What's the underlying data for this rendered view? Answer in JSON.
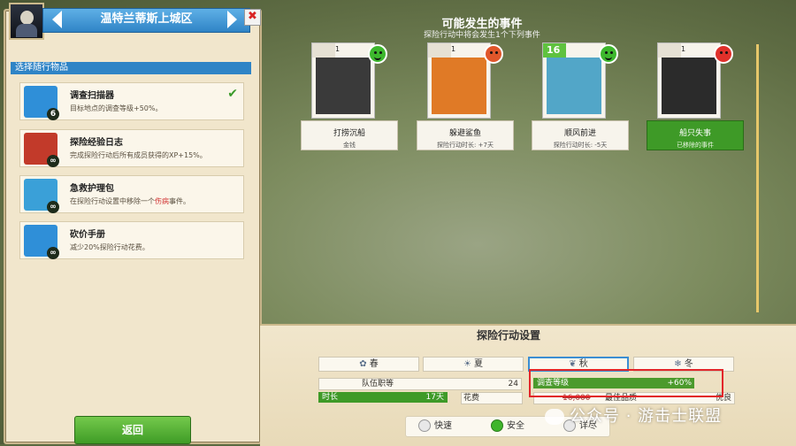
{
  "left_panel": {
    "location": "温特兰蒂斯上城区",
    "close_label": "✖",
    "section_title": "选择随行物品",
    "items": [
      {
        "name": "调查扫描器",
        "desc": "目标地点的调查等级+50%。",
        "badge": "6",
        "selected": true,
        "color": "#2f8fd8"
      },
      {
        "name": "探险经验日志",
        "desc": "完成探险行动后所有成员获得的XP+15%。",
        "badge": "∞",
        "selected": false,
        "color": "#c23a2a"
      },
      {
        "name": "急救护理包",
        "desc_before": "在探险行动设置中移除一个",
        "desc_highlight": "伤病",
        "desc_after": "事件。",
        "badge": "∞",
        "selected": false,
        "color": "#3aa0d8"
      },
      {
        "name": "砍价手册",
        "desc": "减少20%探险行动花费。",
        "badge": "∞",
        "selected": false,
        "color": "#2f8fd8"
      }
    ],
    "check_mark": "✔",
    "return_button": "返回"
  },
  "events": {
    "title": "可能发生的事件",
    "subtitle": "探险行动中将会发生1个下列事件",
    "cards": [
      {
        "name": "打捞沉船",
        "sub": "金钱",
        "level": "1",
        "face": "happy",
        "face_color": "#3db72d",
        "art": "#3a3a3a",
        "header": "#e6e1d4"
      },
      {
        "name": "躲避鲨鱼",
        "sub": "探险行动时长: +7天",
        "level": "1",
        "face": "sad",
        "face_color": "#e0562a",
        "art": "#e07a26",
        "header": "#e6e1d4"
      },
      {
        "name": "顺风前进",
        "sub": "探险行动时长: -5天",
        "level": "16",
        "face": "happy",
        "face_color": "#3db72d",
        "art": "#52a6c8",
        "header": "#5fc23f"
      },
      {
        "name": "船只失事",
        "sub": "已移除的事件",
        "level": "1",
        "face": "sad",
        "face_color": "#e0302a",
        "art": "#2b2b2b",
        "header": "#e6e1d4",
        "removed": true
      }
    ]
  },
  "settings": {
    "title": "探险行动设置",
    "seasons": [
      {
        "label": "春",
        "icon": "✿"
      },
      {
        "label": "夏",
        "icon": "☀"
      },
      {
        "label": "秋",
        "icon": "❦"
      },
      {
        "label": "冬",
        "icon": "❄"
      }
    ],
    "selected_season": "秋",
    "crew_label": "队伍职等",
    "crew_value": "24",
    "explore_level_label": "调查等级",
    "explore_level_value": "+60%",
    "duration_label": "时长",
    "duration_value": "17天",
    "cost_label": "花费",
    "cost_value": "16,000",
    "quality_label": "最佳品质",
    "quality_value": "优良",
    "modes": [
      "快速",
      "安全",
      "详尽"
    ],
    "selected_mode": "安全"
  },
  "watermark": "公众号 · 游击士联盟",
  "colors": {
    "accent_blue": "#2f84c6",
    "accent_green": "#3e9a27",
    "highlight_red": "#e2262a"
  }
}
